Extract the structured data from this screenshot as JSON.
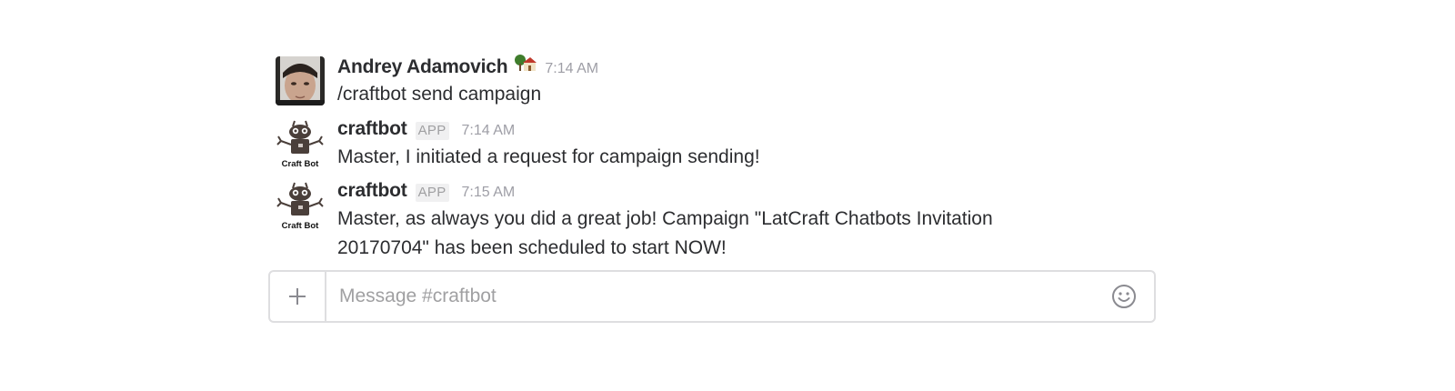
{
  "messages": [
    {
      "sender": "Andrey Adamovich",
      "status_icon": "house-with-tree-icon",
      "time": "7:14 AM",
      "text": "/craftbot send campaign"
    },
    {
      "sender": "craftbot",
      "badge": "APP",
      "avatar_caption": "Craft Bot",
      "time": "7:14 AM",
      "text": "Master, I initiated a request for campaign sending!"
    },
    {
      "sender": "craftbot",
      "badge": "APP",
      "avatar_caption": "Craft Bot",
      "time": "7:15 AM",
      "text": "Master, as always you did a great job! Campaign \"LatCraft Chatbots Invitation 20170704\" has been scheduled to start NOW!"
    }
  ],
  "composer": {
    "placeholder": "Message #craftbot",
    "plus_icon": "plus-icon",
    "emoji_icon": "smiley-icon"
  },
  "colors": {
    "text": "#2c2d30",
    "muted": "#9e9ea6",
    "border": "#dedee0"
  }
}
